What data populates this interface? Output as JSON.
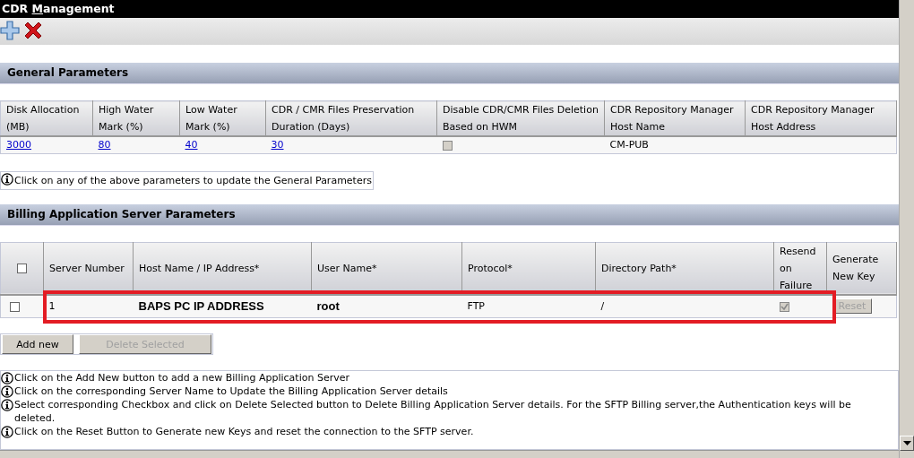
{
  "window": {
    "title": [
      {
        "text": "CDR ",
        "underline": false
      },
      {
        "text": "M",
        "underline": true
      },
      {
        "text": "anagement",
        "underline": false
      }
    ]
  },
  "toolbar": [
    {
      "kind": "add"
    },
    {
      "kind": "delete"
    }
  ],
  "general": {
    "title": "General Parameters",
    "columns": [
      "Disk Allocation (MB)",
      "High Water Mark (%)",
      "Low Water Mark (%)",
      "CDR / CMR Files Preservation Duration (Days)",
      "Disable CDR/CMR Files Deletion Based on HWM",
      "CDR Repository Manager Host Name",
      "CDR Repository Manager Host Address"
    ],
    "row": [
      {
        "kind": "link",
        "text": "3000"
      },
      {
        "kind": "link",
        "text": "80"
      },
      {
        "kind": "link",
        "text": "40"
      },
      {
        "kind": "link",
        "text": "30"
      },
      {
        "kind": "checkbox",
        "checked": false,
        "disabled": true
      },
      {
        "kind": "text",
        "text": "CM-PUB"
      },
      {
        "kind": "empty"
      }
    ],
    "note": "Click on any of the above parameters to update the General Parameters"
  },
  "billing": {
    "title": "Billing Application Server Parameters",
    "header_checkbox": {
      "checked": false
    },
    "columns": [
      "Server Number",
      "Host Name / IP Address*",
      "User Name*",
      "Protocol*",
      "Directory Path*",
      "Resend on Failure",
      "Generate New Key"
    ],
    "rows": [
      {
        "checkbox": {
          "checked": false
        },
        "cells": [
          {
            "kind": "text",
            "text": "1",
            "bold": false
          },
          {
            "kind": "text",
            "text": "BAPS PC IP ADDRESS",
            "bold": true
          },
          {
            "kind": "text",
            "text": "root",
            "bold": true
          },
          {
            "kind": "text",
            "text": "FTP",
            "bold": false
          },
          {
            "kind": "text",
            "text": "/",
            "bold": false
          },
          {
            "kind": "checkbox",
            "checked": true,
            "disabled": true
          },
          {
            "kind": "button",
            "text": "Reset",
            "disabled": true
          }
        ]
      }
    ],
    "buttons": [
      {
        "label": "Add new",
        "disabled": false
      },
      {
        "label": "Delete Selected",
        "disabled": true
      }
    ],
    "notes": [
      "Click on the Add New button to add a new Billing Application Server",
      "Click on the corresponding Server Name to Update the Billing Application Server details",
      "Select corresponding Checkbox and click on Delete Selected button to Delete Billing Application Server details. For the SFTP Billing server,the Authentication keys will be deleted.",
      "Click on the Reset Button to Generate new Keys and reset the connection to the SFTP server."
    ]
  }
}
